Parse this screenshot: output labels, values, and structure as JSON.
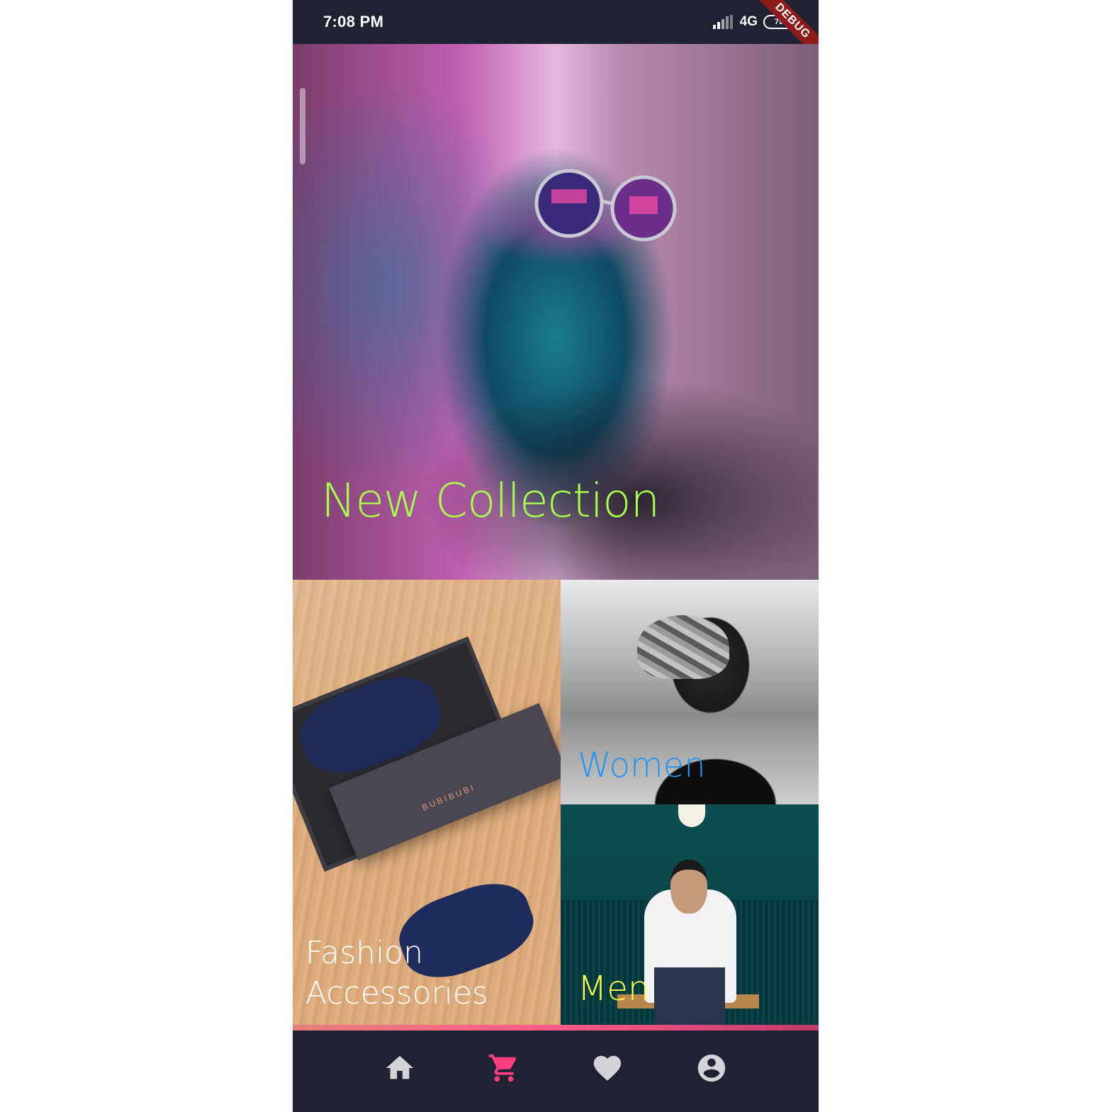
{
  "status_bar": {
    "time": "7:08 PM",
    "network": "4G",
    "battery": "79",
    "debug_banner": "DEBUG"
  },
  "tiles": {
    "hero": {
      "title": "New Collection",
      "title_color": "#a6ff4d"
    },
    "accessories": {
      "title": "Fashion Accessories",
      "brand": "BUBIBUBI",
      "title_color": "#ffffff"
    },
    "women": {
      "title": "Women",
      "title_color": "#2196f3"
    },
    "men": {
      "title": "Men",
      "title_color": "#ffff4d"
    }
  },
  "bottom_nav": {
    "items": [
      {
        "icon": "home-icon",
        "active": false
      },
      {
        "icon": "cart-icon",
        "active": true
      },
      {
        "icon": "heart-icon",
        "active": false
      },
      {
        "icon": "account-icon",
        "active": false
      }
    ],
    "active_color": "#ff3d7f",
    "inactive_color": "#d3d3d8"
  }
}
